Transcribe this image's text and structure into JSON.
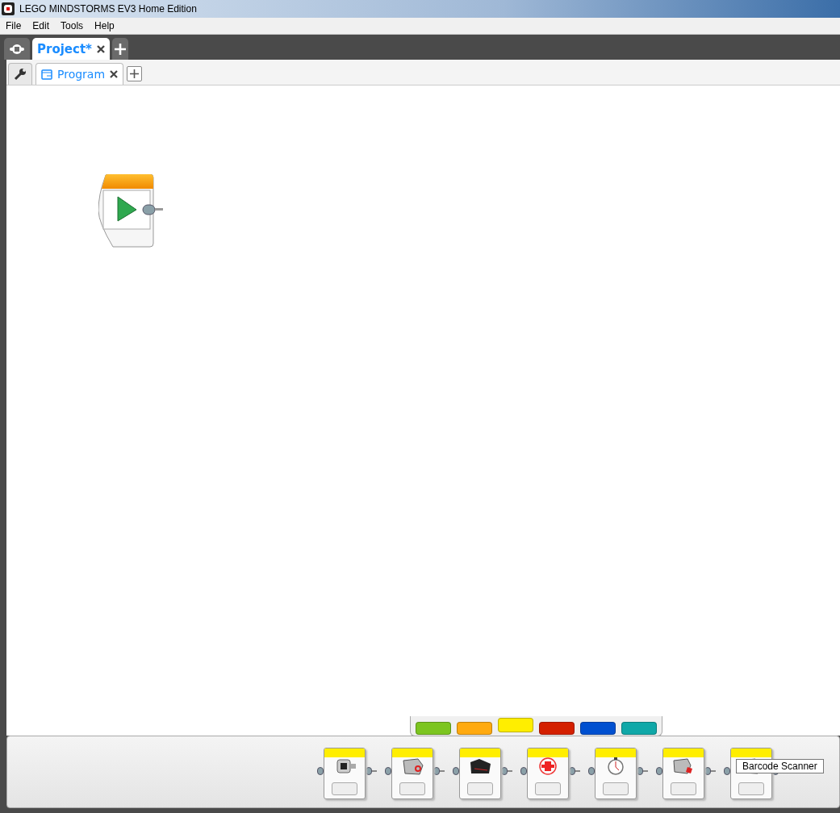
{
  "window": {
    "title": "LEGO MINDSTORMS EV3 Home Edition"
  },
  "menu": [
    "File",
    "Edit",
    "Tools",
    "Help"
  ],
  "project_tabs": [
    {
      "label": "Project*",
      "selected": true
    }
  ],
  "program_tabs": [
    {
      "label": "Program",
      "selected": true
    }
  ],
  "palette_tabs": [
    {
      "color": "#7cc520",
      "selected": false
    },
    {
      "color": "#ffaa10",
      "selected": false
    },
    {
      "color": "#ffee00",
      "selected": true
    },
    {
      "color": "#d42000",
      "selected": false
    },
    {
      "color": "#0050d0",
      "selected": false
    },
    {
      "color": "#10a8a8",
      "selected": false
    }
  ],
  "palette_blocks": [
    {
      "kind": "brick"
    },
    {
      "kind": "color"
    },
    {
      "kind": "infrared"
    },
    {
      "kind": "buttons"
    },
    {
      "kind": "timer"
    },
    {
      "kind": "touch"
    },
    {
      "kind": "scanner"
    }
  ],
  "tooltip": "Barcode Scanner"
}
